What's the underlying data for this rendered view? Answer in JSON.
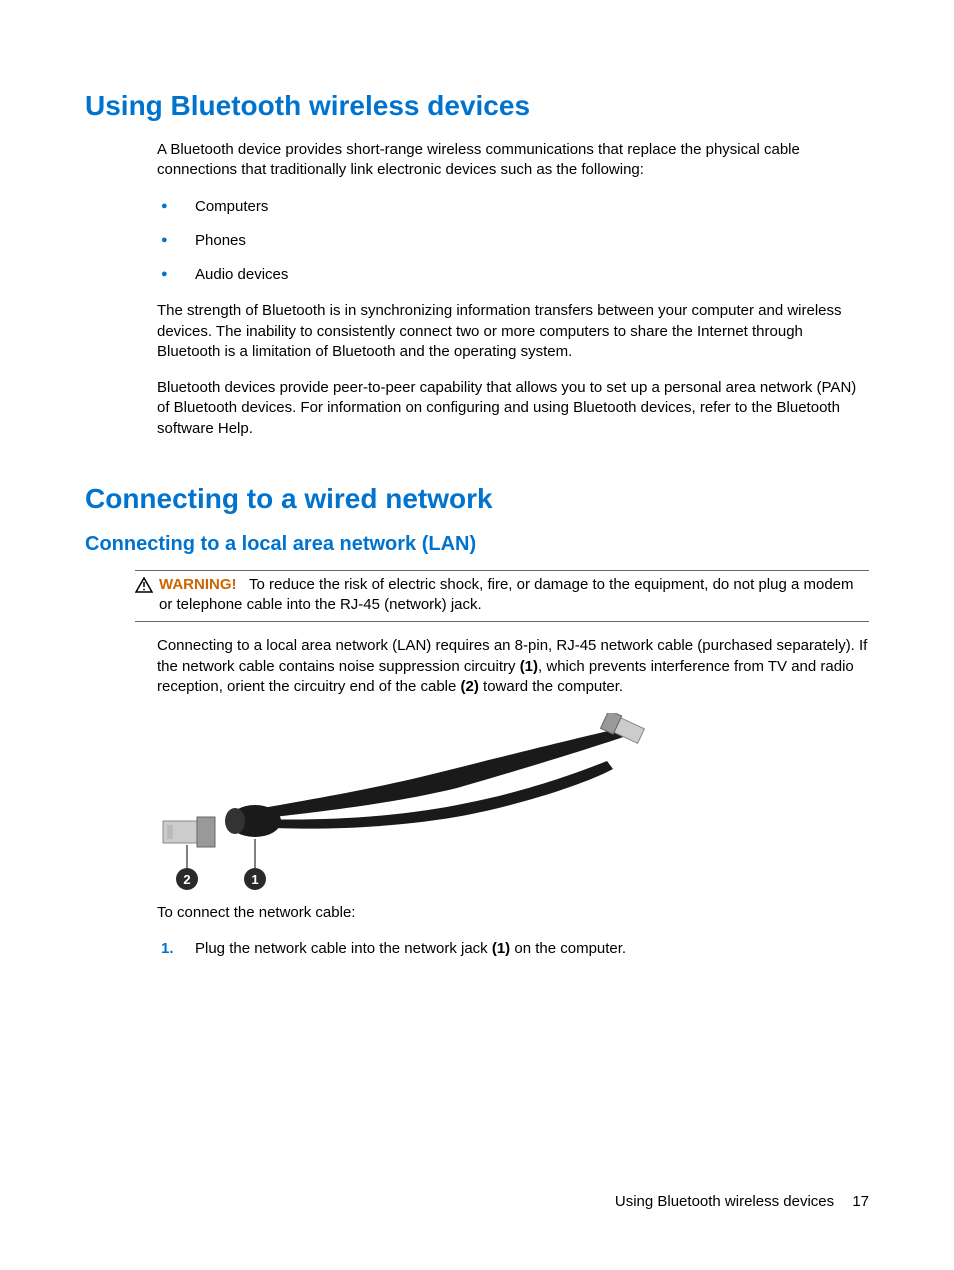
{
  "section1": {
    "title": "Using Bluetooth wireless devices",
    "intro": "A Bluetooth device provides short-range wireless communications that replace the physical cable connections that traditionally link electronic devices such as the following:",
    "bullets": [
      "Computers",
      "Phones",
      "Audio devices"
    ],
    "para2": "The strength of Bluetooth is in synchronizing information transfers between your computer and wireless devices. The inability to consistently connect two or more computers to share the Internet through Bluetooth is a limitation of Bluetooth and the operating system.",
    "para3": "Bluetooth devices provide peer-to-peer capability that allows you to set up a personal area network (PAN) of Bluetooth devices. For information on configuring and using Bluetooth devices, refer to the Bluetooth software Help."
  },
  "section2": {
    "title": "Connecting to a wired network",
    "subtitle": "Connecting to a local area network (LAN)",
    "warning_label": "WARNING!",
    "warning_text": "To reduce the risk of electric shock, fire, or damage to the equipment, do not plug a modem or telephone cable into the RJ-45 (network) jack.",
    "para1_a": "Connecting to a local area network (LAN) requires an 8-pin, RJ-45 network cable (purchased separately). If the network cable contains noise suppression circuitry ",
    "para1_b1": "(1)",
    "para1_c": ", which prevents interference from TV and radio reception, orient the circuitry end of the cable ",
    "para1_b2": "(2)",
    "para1_d": " toward the computer.",
    "caption": "To connect the network cable:",
    "step1_num": "1.",
    "step1_a": "Plug the network cable into the network jack ",
    "step1_b": "(1)",
    "step1_c": " on the computer.",
    "callout1": "1",
    "callout2": "2"
  },
  "footer": {
    "text": "Using Bluetooth wireless devices",
    "page": "17"
  }
}
